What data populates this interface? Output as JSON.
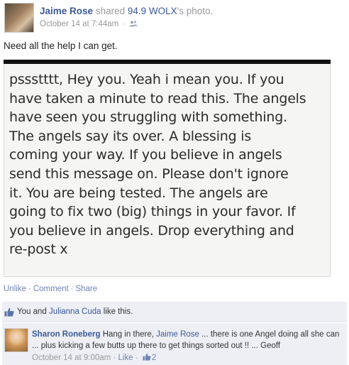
{
  "post": {
    "author": "Jaime Rose",
    "shared_verb": "shared",
    "shared_source": "94.9 WOLX",
    "shared_suffix": "'s photo.",
    "timestamp": "October 14 at 7:44am",
    "meta_separator": "·",
    "privacy_icon": "friends-icon",
    "status_text": "Need all the help I can get."
  },
  "photo": {
    "lines": [
      "pssstttt, Hey you. Yeah i mean you. If you",
      "have taken a minute to read this. The angels",
      "have seen you struggling with something.",
      "The angels say its over. A blessing is",
      "coming your way. If you believe in angels",
      "send this message on. Please don't ignore",
      "it. You are being tested. The angels are",
      "going to fix two (big) things in your favor. If",
      "you believe in angels. Drop everything and",
      "re-post x"
    ]
  },
  "actions": {
    "unlike": "Unlike",
    "comment": "Comment",
    "share": "Share",
    "separator": "·"
  },
  "likes": {
    "icon": "thumbs-up-icon",
    "you": "You and",
    "name": "Julianna Cuda",
    "suffix": "like this."
  },
  "comment": {
    "author": "Sharon Roneberg",
    "text_before": "Hang in there,",
    "mention": "Jaime Rose",
    "text_after": "... there is one Angel doing all she can ... plus kicking a few butts up there to get things sorted out !! ... Geoff",
    "timestamp": "October 14 at 9:00am",
    "separator": "·",
    "like_label": "Like",
    "like_count": "2"
  },
  "colors": {
    "link_blue": "#3b5998",
    "action_blue": "#6d84b4",
    "meta_gray": "#999999",
    "ufi_background": "#edeff4"
  }
}
